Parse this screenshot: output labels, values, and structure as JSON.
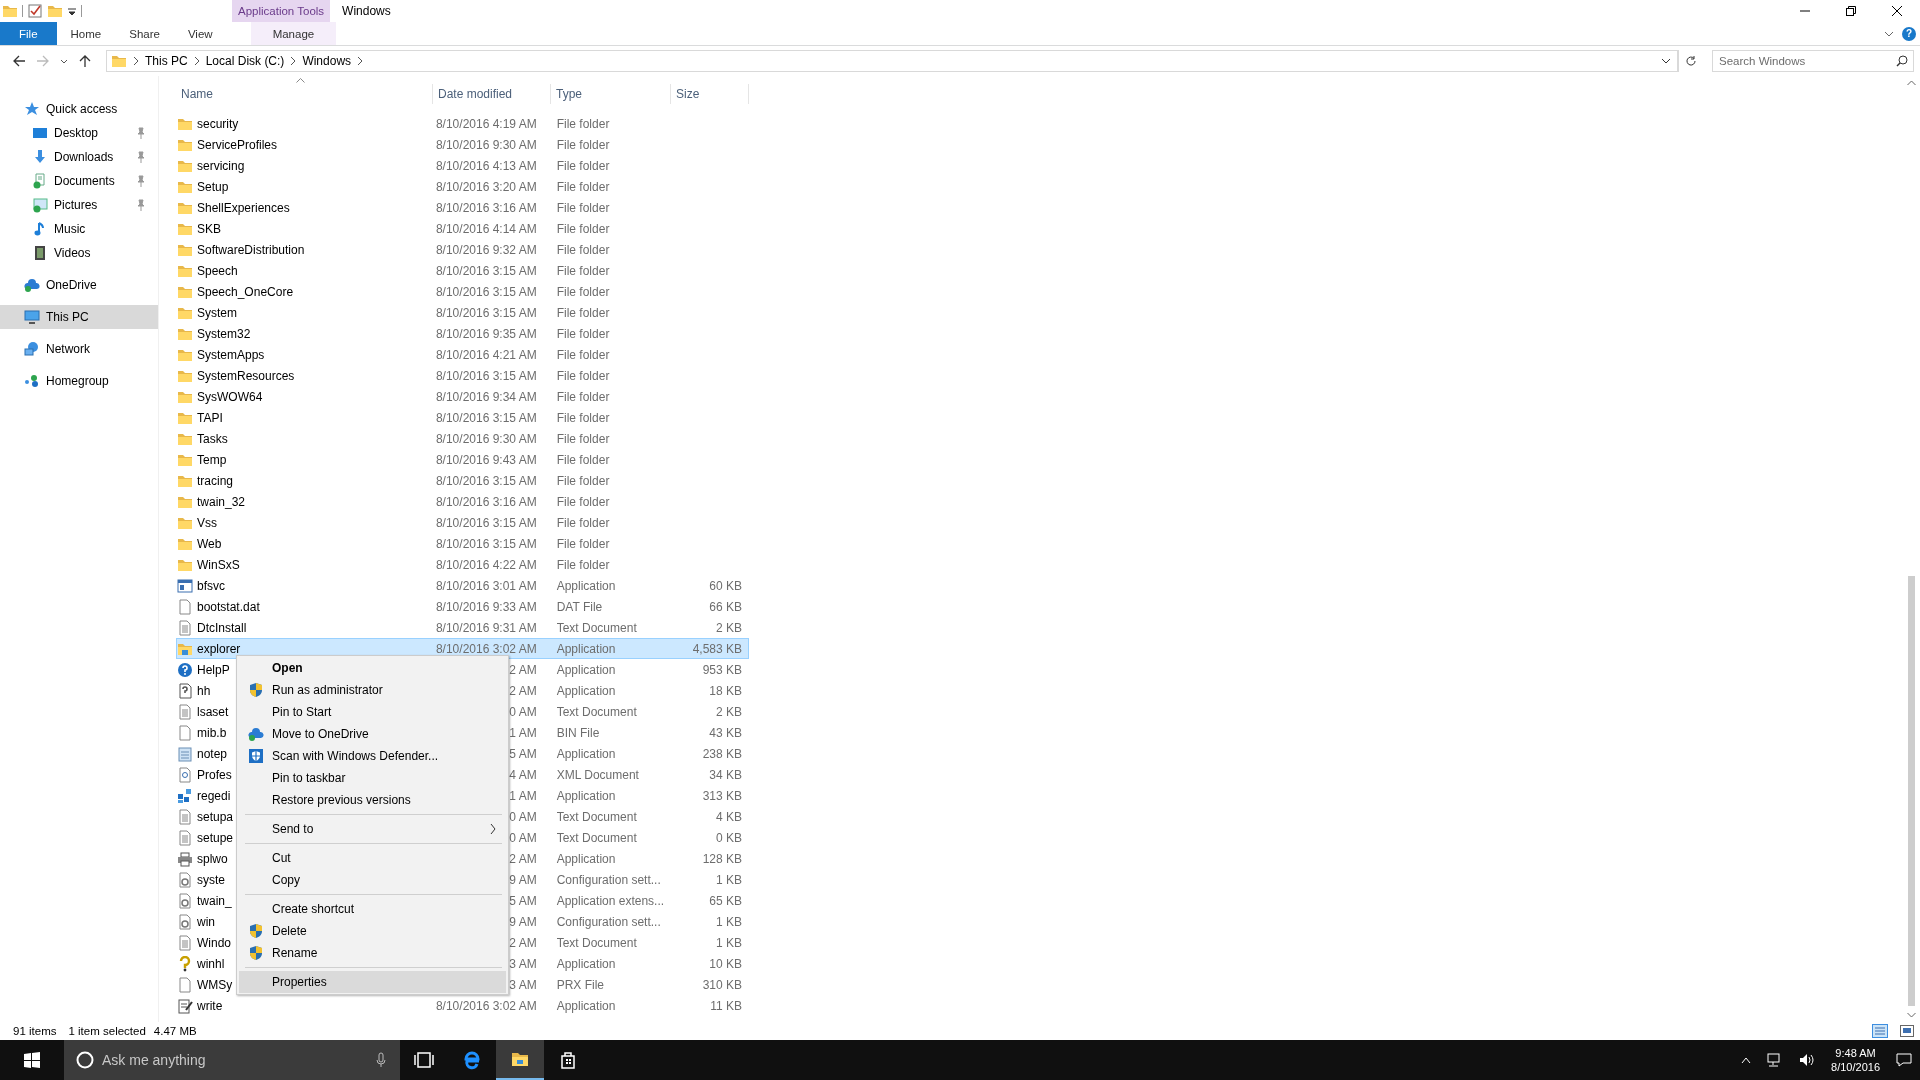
{
  "window": {
    "title": "Windows",
    "context_tab": "Application Tools"
  },
  "ribbon": {
    "tabs": [
      {
        "label": "File",
        "kind": "file",
        "selected": false
      },
      {
        "label": "Home",
        "kind": "plain",
        "selected": false
      },
      {
        "label": "Share",
        "kind": "plain",
        "selected": false
      },
      {
        "label": "View",
        "kind": "plain",
        "selected": false
      },
      {
        "label": "Manage",
        "kind": "contextual",
        "selected": false
      }
    ],
    "help": "?"
  },
  "address": {
    "crumbs": [
      "This PC",
      "Local Disk (C:)",
      "Windows"
    ],
    "search": {
      "placeholder": "Search Windows"
    }
  },
  "sidebar": {
    "items": [
      {
        "label": "Quick access",
        "kind": "star",
        "selected": false,
        "children": [
          {
            "label": "Desktop",
            "kind": "desktop",
            "pinned": true,
            "selected": false
          },
          {
            "label": "Downloads",
            "kind": "download",
            "pinned": true,
            "selected": false
          },
          {
            "label": "Documents",
            "kind": "documents",
            "pinned": true,
            "selected": false
          },
          {
            "label": "Pictures",
            "kind": "pictures",
            "pinned": true,
            "selected": false
          },
          {
            "label": "Music",
            "kind": "music",
            "pinned": false,
            "selected": false
          },
          {
            "label": "Videos",
            "kind": "videos",
            "pinned": false,
            "selected": false
          }
        ]
      },
      {
        "label": "OneDrive",
        "kind": "cloud",
        "selected": false
      },
      {
        "label": "This PC",
        "kind": "pc",
        "selected": true
      },
      {
        "label": "Network",
        "kind": "network",
        "selected": false
      },
      {
        "label": "Homegroup",
        "kind": "homegroup",
        "selected": false
      }
    ]
  },
  "table": {
    "columns": [
      {
        "label": "Name",
        "sorted": true
      },
      {
        "label": "Date modified",
        "sorted": false
      },
      {
        "label": "Type",
        "sorted": false
      },
      {
        "label": "Size",
        "sorted": false
      }
    ],
    "rows": [
      {
        "name": "security",
        "modified": "8/10/2016 4:19 AM",
        "type": "File folder",
        "kind": "folder",
        "selected": false
      },
      {
        "name": "ServiceProfiles",
        "modified": "8/10/2016 9:30 AM",
        "type": "File folder",
        "kind": "folder",
        "selected": false
      },
      {
        "name": "servicing",
        "modified": "8/10/2016 4:13 AM",
        "type": "File folder",
        "kind": "folder",
        "selected": false
      },
      {
        "name": "Setup",
        "modified": "8/10/2016 3:20 AM",
        "type": "File folder",
        "kind": "folder",
        "selected": false
      },
      {
        "name": "ShellExperiences",
        "modified": "8/10/2016 3:16 AM",
        "type": "File folder",
        "kind": "folder",
        "selected": false
      },
      {
        "name": "SKB",
        "modified": "8/10/2016 4:14 AM",
        "type": "File folder",
        "kind": "folder",
        "selected": false
      },
      {
        "name": "SoftwareDistribution",
        "modified": "8/10/2016 9:32 AM",
        "type": "File folder",
        "kind": "folder",
        "selected": false
      },
      {
        "name": "Speech",
        "modified": "8/10/2016 3:15 AM",
        "type": "File folder",
        "kind": "folder",
        "selected": false
      },
      {
        "name": "Speech_OneCore",
        "modified": "8/10/2016 3:15 AM",
        "type": "File folder",
        "kind": "folder",
        "selected": false
      },
      {
        "name": "System",
        "modified": "8/10/2016 3:15 AM",
        "type": "File folder",
        "kind": "folder",
        "selected": false
      },
      {
        "name": "System32",
        "modified": "8/10/2016 9:35 AM",
        "type": "File folder",
        "kind": "folder",
        "selected": false
      },
      {
        "name": "SystemApps",
        "modified": "8/10/2016 4:21 AM",
        "type": "File folder",
        "kind": "folder",
        "selected": false
      },
      {
        "name": "SystemResources",
        "modified": "8/10/2016 3:15 AM",
        "type": "File folder",
        "kind": "folder",
        "selected": false
      },
      {
        "name": "SysWOW64",
        "modified": "8/10/2016 9:34 AM",
        "type": "File folder",
        "kind": "folder",
        "selected": false
      },
      {
        "name": "TAPI",
        "modified": "8/10/2016 3:15 AM",
        "type": "File folder",
        "kind": "folder",
        "selected": false
      },
      {
        "name": "Tasks",
        "modified": "8/10/2016 9:30 AM",
        "type": "File folder",
        "kind": "folder",
        "selected": false
      },
      {
        "name": "Temp",
        "modified": "8/10/2016 9:43 AM",
        "type": "File folder",
        "kind": "folder",
        "selected": false
      },
      {
        "name": "tracing",
        "modified": "8/10/2016 3:15 AM",
        "type": "File folder",
        "kind": "folder",
        "selected": false
      },
      {
        "name": "twain_32",
        "modified": "8/10/2016 3:16 AM",
        "type": "File folder",
        "kind": "folder",
        "selected": false
      },
      {
        "name": "Vss",
        "modified": "8/10/2016 3:15 AM",
        "type": "File folder",
        "kind": "folder",
        "selected": false
      },
      {
        "name": "Web",
        "modified": "8/10/2016 3:15 AM",
        "type": "File folder",
        "kind": "folder",
        "selected": false
      },
      {
        "name": "WinSxS",
        "modified": "8/10/2016 4:22 AM",
        "type": "File folder",
        "kind": "folder",
        "selected": false
      },
      {
        "name": "bfsvc",
        "modified": "8/10/2016 3:01 AM",
        "type": "Application",
        "size": "60 KB",
        "kind": "window",
        "selected": false
      },
      {
        "name": "bootstat.dat",
        "modified": "8/10/2016 9:33 AM",
        "type": "DAT File",
        "size": "66 KB",
        "kind": "blank",
        "selected": false
      },
      {
        "name": "DtcInstall",
        "modified": "8/10/2016 9:31 AM",
        "type": "Text Document",
        "size": "2 KB",
        "kind": "text",
        "selected": false
      },
      {
        "name": "explorer",
        "modified": "8/10/2016 3:02 AM",
        "type": "Application",
        "size": "4,583 KB",
        "kind": "explorer",
        "selected": true
      },
      {
        "name": "HelpP",
        "modified": "2 AM",
        "type": "Application",
        "size": "953 KB",
        "kind": "help",
        "selected": false
      },
      {
        "name": "hh",
        "modified": "2 AM",
        "type": "Application",
        "size": "18 KB",
        "kind": "helpdoc",
        "selected": false
      },
      {
        "name": "lsaset",
        "modified": "0 AM",
        "type": "Text Document",
        "size": "2 KB",
        "kind": "text",
        "selected": false
      },
      {
        "name": "mib.b",
        "modified": "1 AM",
        "type": "BIN File",
        "size": "43 KB",
        "kind": "blank",
        "selected": false
      },
      {
        "name": "notep",
        "modified": "5 AM",
        "type": "Application",
        "size": "238 KB",
        "kind": "notepad",
        "selected": false
      },
      {
        "name": "Profes",
        "modified": "4 AM",
        "type": "XML Document",
        "size": "34 KB",
        "kind": "xml",
        "selected": false
      },
      {
        "name": "regedi",
        "modified": "1 AM",
        "type": "Application",
        "size": "313 KB",
        "kind": "cubes",
        "selected": false
      },
      {
        "name": "setupa",
        "modified": "0 AM",
        "type": "Text Document",
        "size": "4 KB",
        "kind": "text",
        "selected": false
      },
      {
        "name": "setupe",
        "modified": "0 AM",
        "type": "Text Document",
        "size": "0 KB",
        "kind": "text",
        "selected": false
      },
      {
        "name": "splwo",
        "modified": "2 AM",
        "type": "Application",
        "size": "128 KB",
        "kind": "printer",
        "selected": false
      },
      {
        "name": "syste",
        "modified": "9 AM",
        "type": "Configuration sett...",
        "size": "1 KB",
        "kind": "gear",
        "selected": false
      },
      {
        "name": "twain_",
        "modified": "5 AM",
        "type": "Application extens...",
        "size": "65 KB",
        "kind": "gear",
        "selected": false
      },
      {
        "name": "win",
        "modified": "9 AM",
        "type": "Configuration sett...",
        "size": "1 KB",
        "kind": "gear",
        "selected": false
      },
      {
        "name": "Windo",
        "modified": "2 AM",
        "type": "Text Document",
        "size": "1 KB",
        "kind": "text",
        "selected": false
      },
      {
        "name": "winhl",
        "modified": "3 AM",
        "type": "Application",
        "size": "10 KB",
        "kind": "question",
        "selected": false
      },
      {
        "name": "WMSy",
        "modified": "3 AM",
        "type": "PRX File",
        "size": "310 KB",
        "kind": "blank",
        "selected": false
      },
      {
        "name": "write",
        "modified": "8/10/2016 3:02 AM",
        "type": "Application",
        "size": "11 KB",
        "kind": "pen",
        "selected": false
      }
    ]
  },
  "context_menu": {
    "items": [
      {
        "kind": "plain",
        "label": "Open",
        "bold": true,
        "selected": false
      },
      {
        "kind": "shield",
        "label": "Run as administrator",
        "selected": false
      },
      {
        "kind": "plain",
        "label": "Pin to Start",
        "selected": false
      },
      {
        "kind": "cloud",
        "label": "Move to OneDrive",
        "selected": false
      },
      {
        "kind": "defender",
        "label": "Scan with Windows Defender...",
        "selected": false
      },
      {
        "kind": "plain",
        "label": "Pin to taskbar",
        "selected": false
      },
      {
        "kind": "plain",
        "label": "Restore previous versions",
        "selected": false
      },
      {
        "kind": "separator"
      },
      {
        "kind": "plain",
        "label": "Send to",
        "submenu": true,
        "selected": false
      },
      {
        "kind": "separator"
      },
      {
        "kind": "plain",
        "label": "Cut",
        "selected": false
      },
      {
        "kind": "plain",
        "label": "Copy",
        "selected": false
      },
      {
        "kind": "separator"
      },
      {
        "kind": "plain",
        "label": "Create shortcut",
        "selected": false
      },
      {
        "kind": "shield",
        "label": "Delete",
        "selected": false
      },
      {
        "kind": "shield",
        "label": "Rename",
        "selected": false
      },
      {
        "kind": "separator"
      },
      {
        "kind": "plain",
        "label": "Properties",
        "selected": true
      }
    ]
  },
  "status_bar": {
    "count": "91 items",
    "selection": "1 item selected",
    "size": "4.47 MB"
  },
  "taskbar": {
    "search": {
      "placeholder": "Ask me anything"
    },
    "apps": [
      {
        "kind": "taskview",
        "active": false
      },
      {
        "kind": "browser",
        "active": false
      },
      {
        "kind": "explorer",
        "active": true
      },
      {
        "kind": "store",
        "active": false
      }
    ],
    "clock": {
      "time": "9:48 AM",
      "date": "8/10/2016"
    }
  }
}
